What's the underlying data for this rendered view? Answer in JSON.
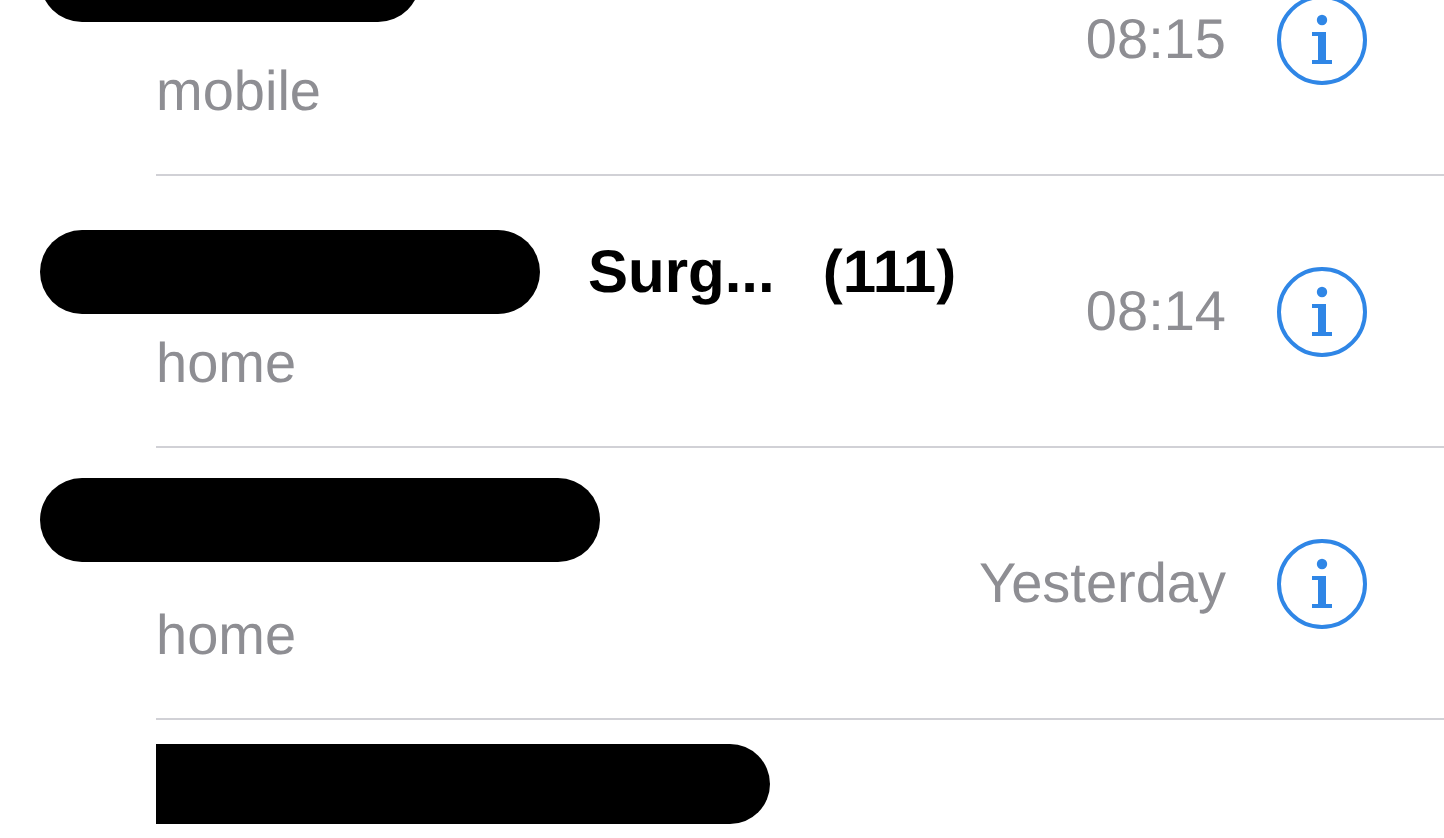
{
  "calls": [
    {
      "name_redacted": true,
      "label": "mobile",
      "time": "08:15"
    },
    {
      "name_redacted": true,
      "name": "Surg...",
      "count": "(111)",
      "label": "home",
      "time": "08:14"
    },
    {
      "name_redacted": true,
      "label": "home",
      "time": "Yesterday"
    },
    {
      "name_redacted": true
    }
  ]
}
